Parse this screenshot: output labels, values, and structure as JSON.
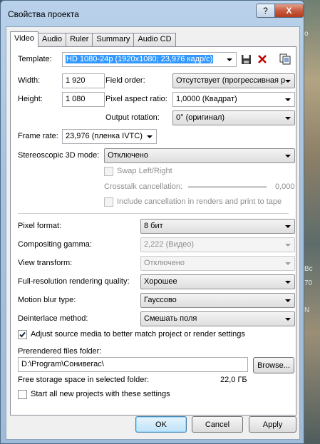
{
  "window": {
    "title": "Свойства проекта",
    "help_glyph": "?",
    "close_glyph": "X"
  },
  "tabs": [
    "Video",
    "Audio",
    "Ruler",
    "Summary",
    "Audio CD"
  ],
  "active_tab": "Video",
  "video": {
    "template_label": "Template:",
    "template_value": "HD 1080-24p (1920x1080; 23,976 кадр/с)",
    "width_label": "Width:",
    "width_value": "1 920",
    "height_label": "Height:",
    "height_value": "1 080",
    "field_order_label": "Field order:",
    "field_order_value": "Отсутствует (прогрессивная р",
    "pixel_aspect_label": "Pixel aspect ratio:",
    "pixel_aspect_value": "1,0000 (Квадрат)",
    "output_rotation_label": "Output rotation:",
    "output_rotation_value": "0° (оригинал)",
    "frame_rate_label": "Frame rate:",
    "frame_rate_value": "23,976 (пленка IVTC)",
    "stereo_label": "Stereoscopic 3D mode:",
    "stereo_value": "Отключено",
    "swap_label": "Swap Left/Right",
    "crosstalk_label": "Crosstalk cancellation:",
    "crosstalk_value": "0,000",
    "include_cancel_label": "Include cancellation in renders and print to tape",
    "pixel_format_label": "Pixel format:",
    "pixel_format_value": "8 бит",
    "compositing_gamma_label": "Compositing gamma:",
    "compositing_gamma_value": "2,222 (Видео)",
    "view_transform_label": "View transform:",
    "view_transform_value": "Отключено",
    "full_res_label": "Full-resolution rendering quality:",
    "full_res_value": "Хорошее",
    "motion_blur_label": "Motion blur type:",
    "motion_blur_value": "Гауссово",
    "deinterlace_label": "Deinterlace method:",
    "deinterlace_value": "Смешать поля",
    "adjust_source_label": "Adjust source media to better match project or render settings",
    "adjust_source_checked": true,
    "prerendered_label": "Prerendered files folder:",
    "prerendered_value": "D:\\Program\\Сонивегас\\",
    "browse_label": "Browse...",
    "free_storage_label": "Free storage space in selected folder:",
    "free_storage_value": "22,0 ГБ",
    "start_all_label": "Start all new projects with these settings",
    "start_all_checked": false
  },
  "icons": {
    "save": "save-icon",
    "delete": "delete-icon",
    "match_media": "match-media-icon"
  },
  "buttons": {
    "ok": "OK",
    "cancel": "Cancel",
    "apply": "Apply"
  },
  "background": {
    "snippets": [
      "о",
      "Bc",
      "70",
      "N"
    ]
  },
  "colors": {
    "selection": "#3399ff",
    "delete_icon": "#c00000",
    "close_button": "#c75a3e"
  }
}
